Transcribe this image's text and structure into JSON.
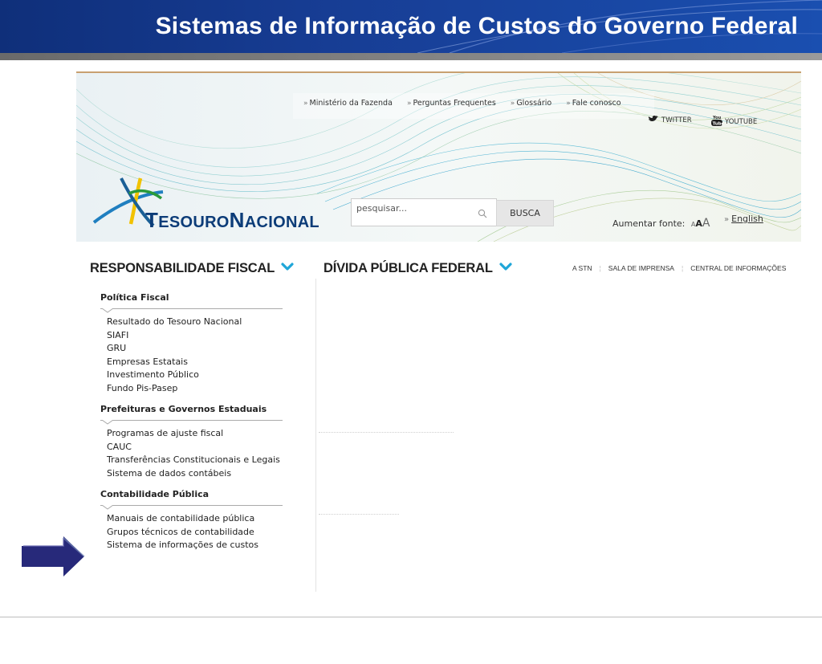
{
  "slide": {
    "title": "Sistemas de Informação de Custos do Governo Federal"
  },
  "site": {
    "top_links": [
      "Ministério da Fazenda",
      "Perguntas Frequentes",
      "Glossário",
      "Fale conosco"
    ],
    "social": {
      "twitter": "TWITTER",
      "youtube": "YOUTUBE"
    },
    "logo": {
      "word1_initial": "T",
      "word1_rest": "ESOURO",
      "word2_initial": "N",
      "word2_rest": "ACIONAL"
    },
    "search": {
      "value": "pesquisar...",
      "button": "BUSCA"
    },
    "font_control": {
      "label": "Aumentar fonte:",
      "small": "A",
      "medium": "A",
      "large": "A"
    },
    "english": "English",
    "nav": {
      "left_heading": "RESPONSABILIDADE FISCAL",
      "center_heading": "DÍVIDA PÚBLICA FEDERAL",
      "right_links": [
        "A STN",
        "SALA DE IMPRENSA",
        "CENTRAL DE INFORMAÇÕES"
      ]
    },
    "menu": [
      {
        "title": "Política Fiscal",
        "items": [
          "Resultado do Tesouro Nacional",
          "SIAFI",
          "GRU",
          "Empresas Estatais",
          "Investimento Público",
          "Fundo Pis-Pasep"
        ]
      },
      {
        "title": "Prefeituras e Governos Estaduais",
        "items": [
          "Programas de ajuste fiscal",
          "CAUC",
          "Transferências Constitucionais e Legais",
          "Sistema de dados contábeis"
        ]
      },
      {
        "title": "Contabilidade Pública",
        "items": [
          "Manuais de contabilidade pública",
          "Grupos técnicos de contabilidade",
          "Sistema de informações de custos"
        ]
      }
    ]
  },
  "colors": {
    "header_blue": "#173d94",
    "accent_cyan": "#1fa6d8",
    "logo_navy": "#0c3c78",
    "arrow_navy": "#27297a"
  }
}
